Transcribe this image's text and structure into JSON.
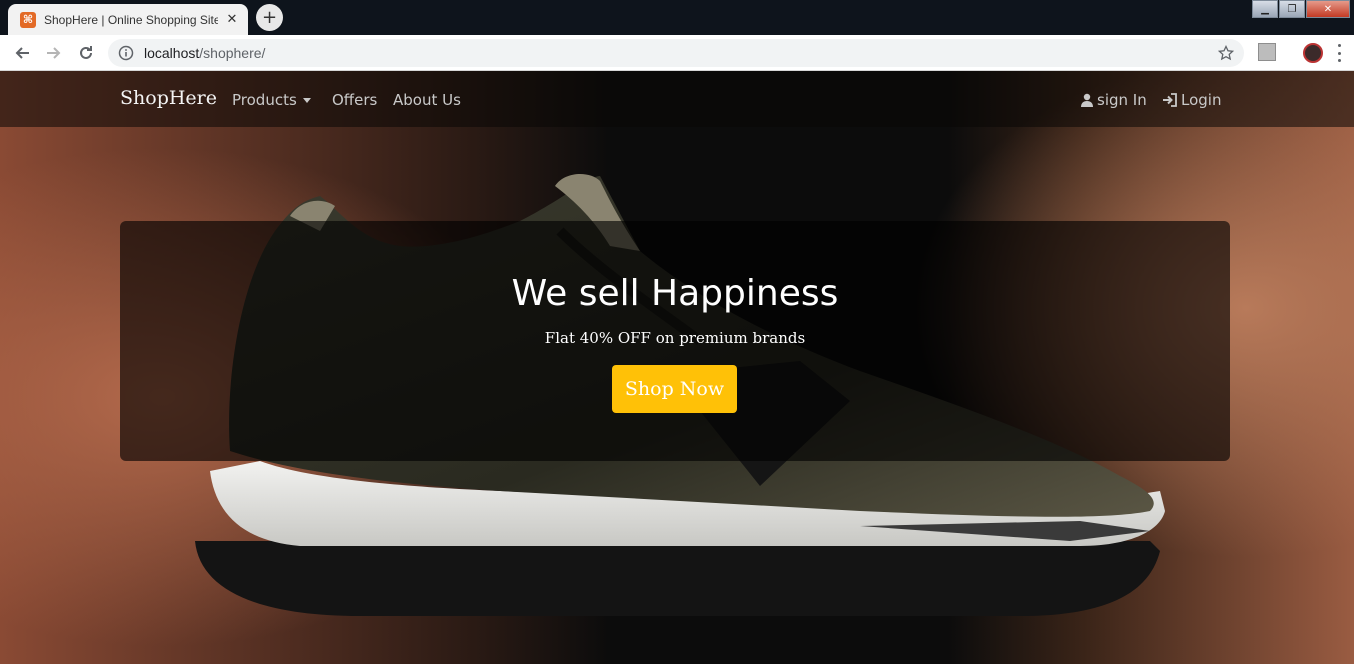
{
  "browser": {
    "tab_title": "ShopHere | Online Shopping Site",
    "tab_close": "✕",
    "new_tab": "+",
    "url_host": "localhost",
    "url_path": "/shophere/"
  },
  "navbar": {
    "brand": "ShopHere",
    "links": {
      "products": "Products",
      "offers": "Offers",
      "about": "About Us"
    },
    "signin": "sign In",
    "login": "Login"
  },
  "hero": {
    "title": "We sell Happiness",
    "subtitle": "Flat 40% OFF on premium brands",
    "cta": "Shop Now"
  },
  "colors": {
    "cta": "#ffc107",
    "favicon": "#e36a26"
  }
}
